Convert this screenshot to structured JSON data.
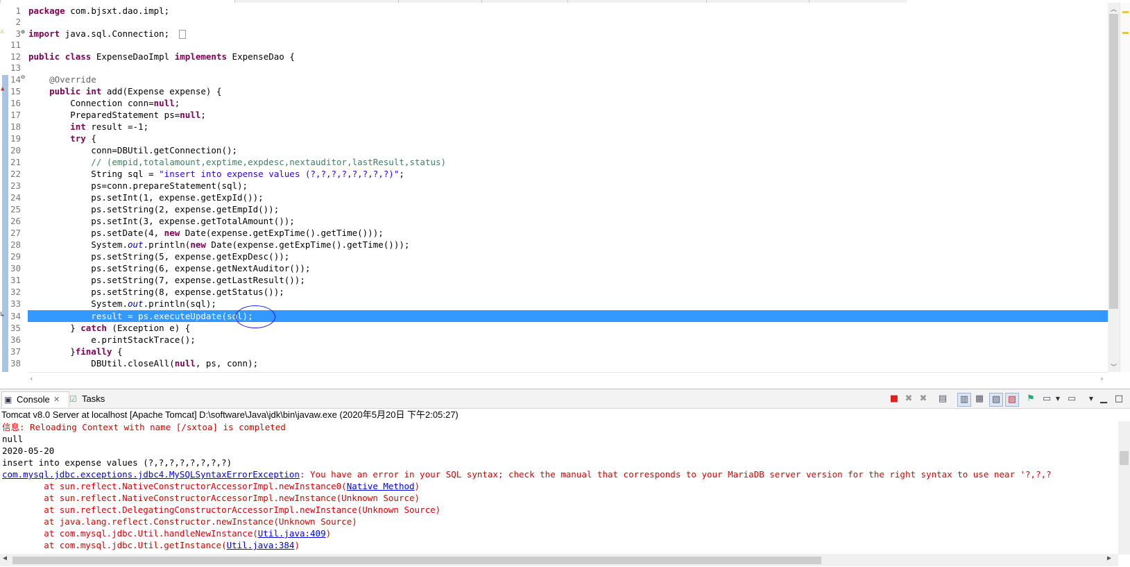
{
  "editor": {
    "lines": [
      {
        "no": "1",
        "text": "package com.bjsxt.dao.impl;"
      },
      {
        "no": "2",
        "text": ""
      },
      {
        "no": "3",
        "text": "import java.sql.Connection;"
      },
      {
        "no": "11",
        "text": ""
      },
      {
        "no": "12",
        "text": "public class ExpenseDaoImpl implements ExpenseDao {"
      },
      {
        "no": "13",
        "text": ""
      },
      {
        "no": "14",
        "text": "    @Override"
      },
      {
        "no": "15",
        "text": "    public int add(Expense expense) {"
      },
      {
        "no": "16",
        "text": "        Connection conn=null;"
      },
      {
        "no": "17",
        "text": "        PreparedStatement ps=null;"
      },
      {
        "no": "18",
        "text": "        int result =-1;"
      },
      {
        "no": "19",
        "text": "        try {"
      },
      {
        "no": "20",
        "text": "            conn=DBUtil.getConnection();"
      },
      {
        "no": "21",
        "text": "            // (empid,totalamount,exptime,expdesc,nextauditor,lastResult,status)"
      },
      {
        "no": "22",
        "text": "            String sql = \"insert into expense values (?,?,?,?,?,?,?,?)\";"
      },
      {
        "no": "23",
        "text": "            ps=conn.prepareStatement(sql);"
      },
      {
        "no": "24",
        "text": "            ps.setInt(1, expense.getExpId());"
      },
      {
        "no": "25",
        "text": "            ps.setString(2, expense.getEmpId());"
      },
      {
        "no": "26",
        "text": "            ps.setInt(3, expense.getTotalAmount());"
      },
      {
        "no": "27",
        "text": "            ps.setDate(4, new Date(expense.getExpTime().getTime()));"
      },
      {
        "no": "28",
        "text": "            System.out.println(new Date(expense.getExpTime().getTime()));"
      },
      {
        "no": "29",
        "text": "            ps.setString(5, expense.getExpDesc());"
      },
      {
        "no": "30",
        "text": "            ps.setString(6, expense.getNextAuditor());"
      },
      {
        "no": "31",
        "text": "            ps.setString(7, expense.getLastResult());"
      },
      {
        "no": "32",
        "text": "            ps.setString(8, expense.getStatus());"
      },
      {
        "no": "33",
        "text": "            System.out.println(sql);"
      },
      {
        "no": "34",
        "text": "            result = ps.executeUpdate(sql);"
      },
      {
        "no": "35",
        "text": "        } catch (Exception e) {"
      },
      {
        "no": "36",
        "text": "            e.printStackTrace();"
      },
      {
        "no": "37",
        "text": "        }finally {"
      },
      {
        "no": "38",
        "text": "            DBUtil.closeAll(null, ps, conn);"
      }
    ],
    "highlighted_line": "34"
  },
  "console": {
    "tabs": [
      {
        "label": "Console",
        "icon": "console-icon",
        "active": true
      },
      {
        "label": "Tasks",
        "icon": "tasks-icon",
        "active": false
      }
    ],
    "header": "Tomcat v8.0 Server at localhost [Apache Tomcat] D:\\software\\Java\\jdk\\bin\\javaw.exe (2020年5月20日 下午2:05:27)",
    "lines": [
      {
        "type": "err",
        "text": "信息: Reloading Context with name [/sxtoa] is completed"
      },
      {
        "type": "plain",
        "text": "null"
      },
      {
        "type": "plain",
        "text": "2020-05-20"
      },
      {
        "type": "plain",
        "text": "insert into expense values (?,?,?,?,?,?,?,?)"
      },
      {
        "type": "exception",
        "link": "com.mysql.jdbc.exceptions.jdbc4.MySQLSyntaxErrorException",
        "text": ": You have an error in your SQL syntax; check the manual that corresponds to your MariaDB server version for the right syntax to use near '?,?,?"
      },
      {
        "type": "trace",
        "text": "        at sun.reflect.NativeConstructorAccessorImpl.newInstance0(",
        "link": "Native Method",
        "tail": ")"
      },
      {
        "type": "trace",
        "text": "        at sun.reflect.NativeConstructorAccessorImpl.newInstance(Unknown Source)",
        "link": "",
        "tail": ""
      },
      {
        "type": "trace",
        "text": "        at sun.reflect.DelegatingConstructorAccessorImpl.newInstance(Unknown Source)",
        "link": "",
        "tail": ""
      },
      {
        "type": "trace",
        "text": "        at java.lang.reflect.Constructor.newInstance(Unknown Source)",
        "link": "",
        "tail": ""
      },
      {
        "type": "trace",
        "text": "        at com.mysql.jdbc.Util.handleNewInstance(",
        "link": "Util.java:409",
        "tail": ")"
      },
      {
        "type": "trace",
        "text": "        at com.mysql.jdbc.Util.getInstance(",
        "link": "Util.java:384",
        "tail": ")"
      }
    ],
    "colors": {
      "error": "#e00000",
      "link": "#0000ee",
      "selection": "#3399ff"
    }
  }
}
